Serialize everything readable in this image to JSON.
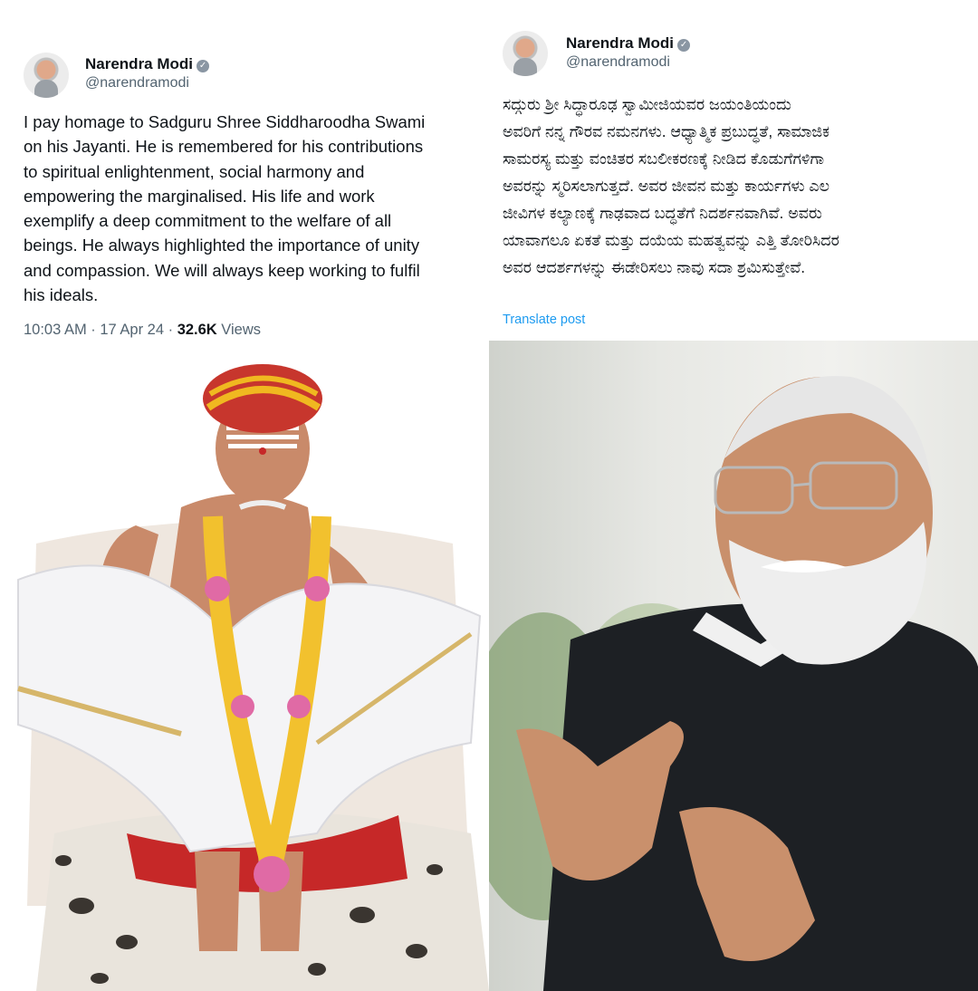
{
  "left_post": {
    "author_name": "Narendra Modi",
    "handle": "@narendramodi",
    "text": "I pay homage to Sadguru Shree Siddharoodha Swami\non his Jayanti. He is remembered for his contributions\nto spiritual enlightenment, social harmony and\nempowering the marginalised. His life and work\nexemplify a deep commitment to the welfare of all\nbeings. He always highlighted the importance of unity\nand compassion. We will always keep working to fulfil\nhis ideals.",
    "time": "10:03 AM · 17 Apr 24 · ",
    "views_count": "32.6K",
    "views_label": " Views"
  },
  "right_post": {
    "author_name": "Narendra Modi",
    "handle": "@narendramodi",
    "text": "ಸದ್ಗುರು ಶ್ರೀ ಸಿದ್ಧಾರೂಢ ಸ್ವಾಮೀಜಿಯವರ ಜಯಂತಿಯಂದು\nಅವರಿಗೆ ನನ್ನ ಗೌರವ ನಮನಗಳು. ಆಧ್ಯಾತ್ಮಿಕ ಪ್ರಬುದ್ಧತೆ, ಸಾಮಾಜಿಕ\nಸಾಮರಸ್ಯ ಮತ್ತು ವಂಚಿತರ ಸಬಲೀಕರಣಕ್ಕೆ ನೀಡಿದ ಕೊಡುಗೆಗಳಿಗಾ\nಅವರನ್ನು ಸ್ಮರಿಸಲಾಗುತ್ತದೆ. ಅವರ ಜೀವನ ಮತ್ತು ಕಾರ್ಯಗಳು ಎಲ\nಜೀವಿಗಳ ಕಲ್ಯಾಣಕ್ಕೆ ಗಾಢವಾದ ಬದ್ಧತೆಗೆ ನಿದರ್ಶನವಾಗಿವೆ. ಅವರು\nಯಾವಾಗಲೂ ಏಕತೆ ಮತ್ತು ದಯೆಯ ಮಹತ್ವವನ್ನು ಎತ್ತಿ ತೋರಿಸಿದರ\nಅವರ ಆದರ್ಶಗಳನ್ನು ಈಡೇರಿಸಲು ನಾವು ಸದಾ ಶ್ರಮಿಸುತ್ತೇವೆ.",
    "translate_label": "Translate post"
  },
  "colors": {
    "text_primary": "#0f1419",
    "text_secondary": "#536471",
    "link_blue": "#1d9bf0",
    "verified_badge": "#8a96a3"
  },
  "icons": {
    "verified": "verified-badge-icon",
    "avatar": "profile-photo"
  }
}
